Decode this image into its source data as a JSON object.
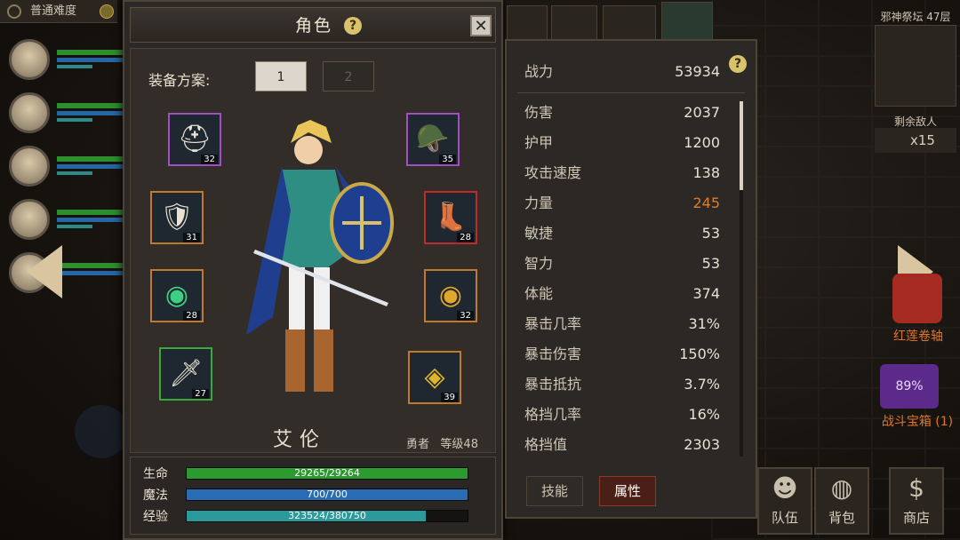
{
  "difficulty": "普通难度",
  "panel": {
    "title": "角色",
    "equip_label": "装备方案:",
    "equip_tabs": [
      "1",
      "2"
    ],
    "hero_name": "艾伦",
    "hero_class": "勇者",
    "hero_level": "等级48"
  },
  "slots": [
    {
      "name": "helmet",
      "level": "32",
      "icon": "helmet-icon",
      "border": "#a04fc0"
    },
    {
      "name": "head-accessory",
      "level": "35",
      "icon": "headgear-icon",
      "border": "#a04fc0"
    },
    {
      "name": "armor",
      "level": "31",
      "icon": "armor-icon",
      "border": "#c07a2a"
    },
    {
      "name": "boots",
      "level": "28",
      "icon": "boots-icon",
      "border": "#c02a2a"
    },
    {
      "name": "ring-green",
      "level": "28",
      "icon": "ring-icon",
      "border": "#c07a2a"
    },
    {
      "name": "ring-gold",
      "level": "32",
      "icon": "ring-icon",
      "border": "#c07a2a"
    },
    {
      "name": "sword",
      "level": "27",
      "icon": "sword-icon",
      "border": "#3aa83a"
    },
    {
      "name": "shield",
      "level": "39",
      "icon": "shield-icon",
      "border": "#c07a2a"
    }
  ],
  "bars": {
    "hp": {
      "label": "生命",
      "text": "29265/29264",
      "fill": 1.0,
      "color": "#2b9a2f"
    },
    "mp": {
      "label": "魔法",
      "text": "700/700",
      "fill": 1.0,
      "color": "#2a6cb3"
    },
    "xp": {
      "label": "经验",
      "text": "323524/380750",
      "fill": 0.85,
      "color": "#2a9a9a"
    }
  },
  "stats": {
    "power_label": "战力",
    "power_value": "53934",
    "rows": [
      {
        "k": "伤害",
        "v": "2037"
      },
      {
        "k": "护甲",
        "v": "1200"
      },
      {
        "k": "攻击速度",
        "v": "138"
      },
      {
        "k": "力量",
        "v": "245",
        "hl": true
      },
      {
        "k": "敏捷",
        "v": "53"
      },
      {
        "k": "智力",
        "v": "53"
      },
      {
        "k": "体能",
        "v": "374"
      },
      {
        "k": "暴击几率",
        "v": "31%"
      },
      {
        "k": "暴击伤害",
        "v": "150%"
      },
      {
        "k": "暴击抵抗",
        "v": "3.7%"
      },
      {
        "k": "格挡几率",
        "v": "16%"
      },
      {
        "k": "格挡值",
        "v": "2303"
      }
    ],
    "tabs": [
      "技能",
      "属性"
    ],
    "highlight_color": "#e07b2a"
  },
  "right": {
    "altar": "邪神祭坛 47层",
    "enemies_label": "剩余敌人",
    "enemies_count": "x15",
    "scroll_label": "红莲卷轴",
    "chest_label": "战斗宝箱 (1)",
    "chest_pct": "89%"
  },
  "bottom": {
    "team": "队伍",
    "bag": "背包",
    "shop": "商店"
  }
}
